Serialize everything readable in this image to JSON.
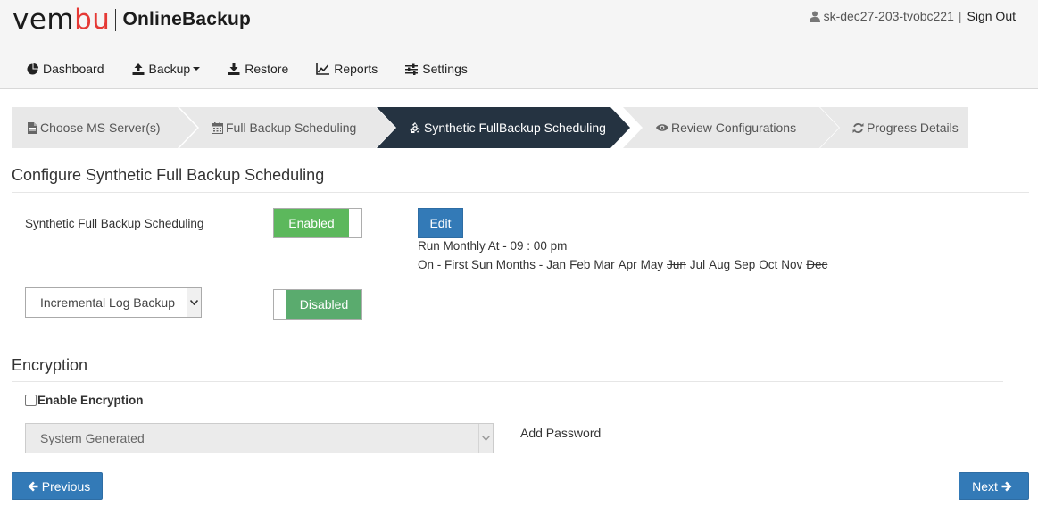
{
  "header": {
    "logo_prefix": "vem",
    "logo_suffix": "bu",
    "product": "OnlineBackup",
    "user": "sk-dec27-203-tvobc221",
    "separator": "|",
    "sign_out": "Sign Out"
  },
  "nav": {
    "items": [
      {
        "label": "Dashboard",
        "icon": "dashboard-icon"
      },
      {
        "label": "Backup",
        "icon": "upload-icon"
      },
      {
        "label": "Restore",
        "icon": "download-icon"
      },
      {
        "label": "Reports",
        "icon": "line-chart-icon"
      },
      {
        "label": "Settings",
        "icon": "sliders-icon"
      }
    ]
  },
  "wizard": {
    "steps": [
      {
        "label": "Choose MS Server(s)",
        "icon": "file-icon",
        "active": false
      },
      {
        "label": "Full Backup Scheduling",
        "icon": "calendar-icon",
        "active": false
      },
      {
        "label": "Synthetic FullBackup Scheduling",
        "icon": "recycle-icon",
        "active": true
      },
      {
        "label": "Review Configurations",
        "icon": "eye-icon",
        "active": false
      },
      {
        "label": "Progress Details",
        "icon": "refresh-icon",
        "active": false
      }
    ]
  },
  "synthetic": {
    "section_title": "Configure Synthetic Full Backup Scheduling",
    "label": "Synthetic Full Backup Scheduling",
    "toggle_label": "Enabled",
    "edit_label": "Edit",
    "run_text": "Run Monthly At - 09 : 00 pm",
    "on_prefix": "On - First Sun Months -",
    "months": [
      {
        "name": "Jan",
        "selected": true
      },
      {
        "name": "Feb",
        "selected": true
      },
      {
        "name": "Mar",
        "selected": true
      },
      {
        "name": "Apr",
        "selected": true
      },
      {
        "name": "May",
        "selected": true
      },
      {
        "name": "Jun",
        "selected": false
      },
      {
        "name": "Jul",
        "selected": true
      },
      {
        "name": "Aug",
        "selected": true
      },
      {
        "name": "Sep",
        "selected": true
      },
      {
        "name": "Oct",
        "selected": true
      },
      {
        "name": "Nov",
        "selected": true
      },
      {
        "name": "Dec",
        "selected": false
      }
    ]
  },
  "incremental": {
    "select_value": "Incremental Log Backup",
    "toggle_label": "Disabled"
  },
  "encryption": {
    "section_title": "Encryption",
    "checkbox_label": "Enable Encryption",
    "checked": false,
    "type_value": "System Generated",
    "add_password": "Add Password"
  },
  "footer": {
    "previous": "Previous",
    "next": "Next"
  },
  "colors": {
    "active_step": "#253341",
    "inactive_step": "#e8e8e8",
    "primary_button": "#337ab7",
    "toggle_on": "#5cb85c",
    "brand_red": "#e53935"
  }
}
